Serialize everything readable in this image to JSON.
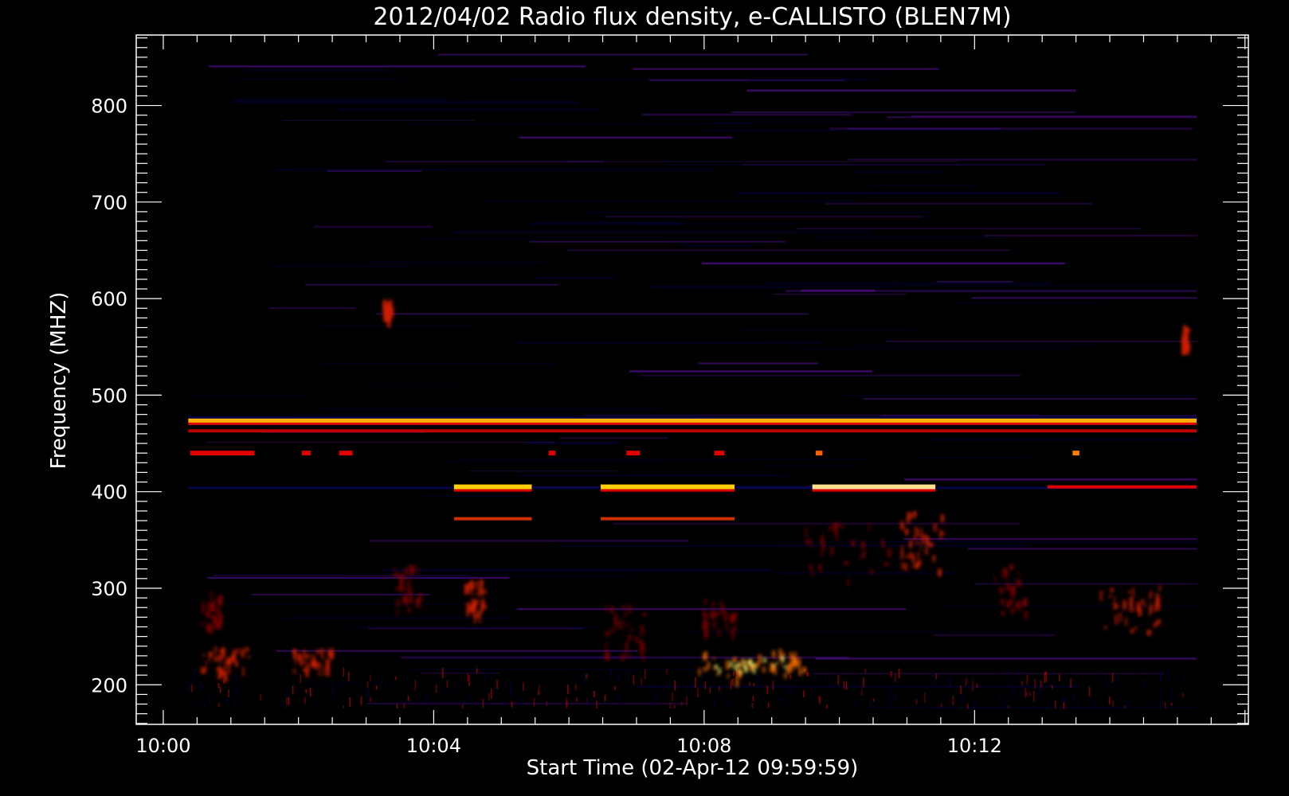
{
  "chart_data": {
    "type": "heatmap",
    "title": "2012/04/02  Radio flux density, e-CALLISTO (BLEN7M)",
    "xlabel": "Start Time (02-Apr-12 09:59:59)",
    "ylabel": "Frequency (MHZ)",
    "x_ticks": [
      "10:00",
      "10:04",
      "10:08",
      "10:12"
    ],
    "x_tick_minutes": [
      0,
      4,
      8,
      12
    ],
    "y_ticks": [
      "200",
      "300",
      "400",
      "500",
      "600",
      "700",
      "800"
    ],
    "y_tick_values": [
      200,
      300,
      400,
      500,
      600,
      700,
      800
    ],
    "xlim_minutes": [
      -0.4,
      16.05
    ],
    "ylim_mhz": [
      873,
      159
    ],
    "data_x_range_minutes": [
      0.37,
      15.35
    ],
    "data_y_range_mhz": [
      176,
      870
    ],
    "colormap": {
      "background": "#1010e0",
      "low": "#00003a",
      "mid": "#b40000",
      "high": "#ff5a00",
      "peak": "#ffff66"
    },
    "interference_lines": [
      {
        "freq": 404,
        "t0": 0.37,
        "t1": 15.35,
        "color": "#05054a",
        "intensity": 1
      },
      {
        "freq": 463,
        "t0": 0.37,
        "t1": 15.35,
        "color": "#c00000",
        "intensity": 2
      },
      {
        "freq": 474,
        "t0": 0.37,
        "t1": 15.35,
        "color": "#ffb000",
        "intensity": 3
      },
      {
        "freq": 477,
        "t0": 0.37,
        "t1": 15.35,
        "color": "#000040",
        "intensity": 1
      },
      {
        "freq": 372,
        "t0": 4.3,
        "t1": 5.45,
        "color": "#d03000",
        "intensity": 2
      },
      {
        "freq": 405,
        "t0": 4.3,
        "t1": 5.45,
        "color": "#ffd000",
        "intensity": 3
      },
      {
        "freq": 372,
        "t0": 6.47,
        "t1": 8.45,
        "color": "#d03000",
        "intensity": 2
      },
      {
        "freq": 405,
        "t0": 6.47,
        "t1": 8.45,
        "color": "#ffd000",
        "intensity": 3
      },
      {
        "freq": 405,
        "t0": 9.6,
        "t1": 11.42,
        "color": "#ffe090",
        "intensity": 3
      },
      {
        "freq": 405,
        "t0": 13.08,
        "t1": 15.35,
        "color": "#e00000",
        "intensity": 2
      }
    ],
    "bursts": [
      {
        "t": 0.9,
        "freq": 225,
        "dt": 0.7,
        "dfreq": 30,
        "intensity": 2
      },
      {
        "t": 2.2,
        "freq": 228,
        "dt": 0.6,
        "dfreq": 25,
        "intensity": 2
      },
      {
        "t": 0.7,
        "freq": 280,
        "dt": 0.3,
        "dfreq": 40,
        "intensity": 1
      },
      {
        "t": 3.6,
        "freq": 300,
        "dt": 0.4,
        "dfreq": 50,
        "intensity": 1
      },
      {
        "t": 4.6,
        "freq": 290,
        "dt": 0.3,
        "dfreq": 40,
        "intensity": 2
      },
      {
        "t": 6.8,
        "freq": 260,
        "dt": 0.6,
        "dfreq": 60,
        "intensity": 1
      },
      {
        "t": 8.7,
        "freq": 222,
        "dt": 1.6,
        "dfreq": 30,
        "intensity": 3
      },
      {
        "t": 8.2,
        "freq": 270,
        "dt": 0.5,
        "dfreq": 40,
        "intensity": 1
      },
      {
        "t": 10.1,
        "freq": 340,
        "dt": 1.4,
        "dfreq": 60,
        "intensity": 1
      },
      {
        "t": 11.2,
        "freq": 350,
        "dt": 0.6,
        "dfreq": 60,
        "intensity": 2
      },
      {
        "t": 12.5,
        "freq": 300,
        "dt": 0.5,
        "dfreq": 50,
        "intensity": 1
      },
      {
        "t": 14.3,
        "freq": 280,
        "dt": 0.9,
        "dfreq": 50,
        "intensity": 2
      },
      {
        "t": 3.3,
        "freq": 590,
        "dt": 0.12,
        "dfreq": 20,
        "intensity": 2
      },
      {
        "t": 15.1,
        "freq": 560,
        "dt": 0.08,
        "dfreq": 25,
        "intensity": 2
      }
    ],
    "markers": [
      {
        "t": 0.4,
        "t1": 1.35,
        "freq": 440,
        "color": "#e00000"
      },
      {
        "t": 2.05,
        "t1": 2.18,
        "freq": 440,
        "color": "#e00000"
      },
      {
        "t": 2.6,
        "t1": 2.8,
        "freq": 440,
        "color": "#e00000"
      },
      {
        "t": 5.7,
        "t1": 5.8,
        "freq": 440,
        "color": "#e00000"
      },
      {
        "t": 6.85,
        "t1": 7.05,
        "freq": 440,
        "color": "#e00000"
      },
      {
        "t": 8.15,
        "t1": 8.3,
        "freq": 440,
        "color": "#e00000"
      },
      {
        "t": 9.65,
        "t1": 9.75,
        "freq": 440,
        "color": "#ff6000"
      },
      {
        "t": 13.45,
        "t1": 13.55,
        "freq": 440,
        "color": "#ff8000"
      }
    ],
    "grid": false,
    "legend": "none"
  }
}
